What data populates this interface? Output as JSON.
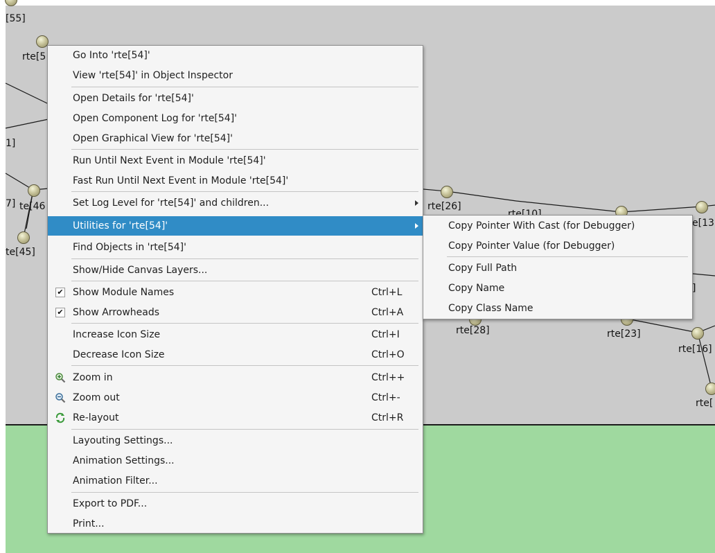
{
  "canvas": {
    "node_labels": {
      "rte55": "[55]",
      "rte5x": "rte[5",
      "rte1x": "1]",
      "rte7x": "7]",
      "rte46": "te[46",
      "rte45": "te[45]",
      "rte26": "rte[26]",
      "rte10": "rte[10]",
      "rte13": "e[13",
      "rte28": "rte[28]",
      "rte23": "rte[23]",
      "rte16": "rte[16]",
      "rteX": "rte[",
      "bracket": "]"
    },
    "colors": {
      "canvas_bg": "#cbcbcb",
      "lower_bg": "#9fd99f",
      "node": "#c7c39a"
    }
  },
  "context_menu": {
    "items": [
      {
        "label": "Go Into 'rte[54]'"
      },
      {
        "label": "View 'rte[54]' in Object Inspector"
      },
      {
        "label": "Open Details for 'rte[54]'"
      },
      {
        "label": "Open Component Log for 'rte[54]'"
      },
      {
        "label": "Open Graphical View for 'rte[54]'"
      },
      {
        "label": "Run Until Next Event in Module 'rte[54]'"
      },
      {
        "label": "Fast Run Until Next Event in Module 'rte[54]'"
      },
      {
        "label": "Set Log Level for 'rte[54]' and children..."
      },
      {
        "label": "Utilities for 'rte[54]'"
      },
      {
        "label": "Find Objects in 'rte[54]'"
      },
      {
        "label": "Show/Hide Canvas Layers..."
      },
      {
        "label": "Show Module Names",
        "shortcut": "Ctrl+L",
        "check": "✔"
      },
      {
        "label": "Show Arrowheads",
        "shortcut": "Ctrl+A",
        "check": "✔"
      },
      {
        "label": "Increase Icon Size",
        "shortcut": "Ctrl+I"
      },
      {
        "label": "Decrease Icon Size",
        "shortcut": "Ctrl+O"
      },
      {
        "label": "Zoom in",
        "shortcut": "Ctrl++",
        "icon": "zoom-in-icon"
      },
      {
        "label": "Zoom out",
        "shortcut": "Ctrl+-",
        "icon": "zoom-out-icon"
      },
      {
        "label": "Re-layout",
        "shortcut": "Ctrl+R",
        "icon": "relayout-icon"
      },
      {
        "label": "Layouting Settings..."
      },
      {
        "label": "Animation Settings..."
      },
      {
        "label": "Animation Filter..."
      },
      {
        "label": "Export to PDF..."
      },
      {
        "label": "Print..."
      }
    ],
    "highlight_color": "#308cc6"
  },
  "submenu": {
    "items": [
      {
        "label": "Copy Pointer With Cast (for Debugger)"
      },
      {
        "label": "Copy Pointer Value (for Debugger)"
      },
      {
        "label": "Copy Full Path"
      },
      {
        "label": "Copy Name"
      },
      {
        "label": "Copy Class Name"
      }
    ]
  }
}
